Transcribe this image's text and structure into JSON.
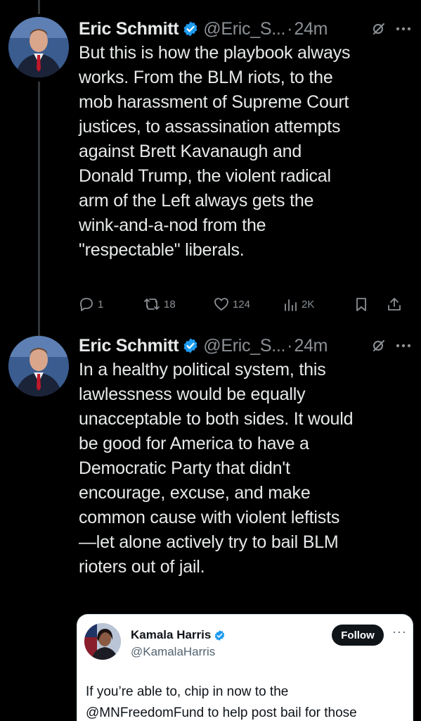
{
  "tweets": [
    {
      "author_name": "Eric Schmitt",
      "author_handle": "@Eric_S...",
      "separator": "·",
      "time": "24m",
      "text": "But this is how the playbook always\nworks. From the BLM riots, to the\nmob harassment of Supreme Court\njustices, to assassination attempts\nagainst Brett Kavanaugh and\nDonald Trump, the violent radical\narm of the Left always gets the\nwink-and-a-nod from the\n\"respectable\" liberals.",
      "replies": "1",
      "reposts": "18",
      "likes": "124",
      "views": "2K"
    },
    {
      "author_name": "Eric Schmitt",
      "author_handle": "@Eric_S...",
      "separator": "·",
      "time": "24m",
      "text": "In a healthy political system, this\nlawlessness would be equally\nunacceptable to both sides. It would\nbe good for America to have a\nDemocratic Party that didn't\nencourage, excuse, and make\ncommon cause with violent leftists\n—let alone actively try to bail BLM\nrioters out of jail."
    }
  ],
  "quoted": {
    "author_name": "Kamala Harris",
    "author_handle": "@KamalaHarris",
    "follow_label": "Follow",
    "more": "···",
    "text": "If you’re able to, chip in now to the\n@MNFreedomFund to help post bail for those"
  },
  "colors": {
    "background": "#000000",
    "text": "#e7e9ea",
    "muted": "#8b9095",
    "verified_blue": "#1d9bf0",
    "thread_line": "#333639"
  },
  "icons": {
    "verified": "verified-badge-icon",
    "grok": "grok-icon",
    "more": "more-icon",
    "reply": "reply-icon",
    "repost": "repost-icon",
    "like": "heart-icon",
    "views": "views-icon",
    "bookmark": "bookmark-icon",
    "share": "share-icon"
  }
}
